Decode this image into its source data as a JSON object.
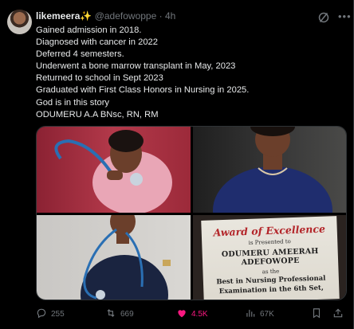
{
  "tweet": {
    "display_name": "likemeera",
    "sparkle_emoji": "✨",
    "handle": "@adefowoppe",
    "separator": "·",
    "time": "4h",
    "lines": [
      "Gained admission in 2018.",
      "Diagnosed with cancer in 2022",
      "Deferred 4 semesters.",
      "Underwent a bone marrow transplant in May, 2023",
      "Returned to school in Sept 2023",
      "Graduated  with First Class Honors in Nursing in 2025.",
      "God is in this story",
      "ODUMERU A.A BNsc, RN, RM"
    ]
  },
  "certificate": {
    "title": "Award of Excellence",
    "presented": "is Presented to",
    "name": "ODUMERU AMEERAH ADEFOWOPE",
    "as_the": "as the",
    "line1": "Best in Nursing Professional",
    "line2": "Examination in the 6th Set,"
  },
  "actions": {
    "replies": "255",
    "reposts": "669",
    "likes": "4.5K",
    "views": "67K"
  },
  "colors": {
    "background": "#000000",
    "text": "#e7e9ea",
    "muted": "#71767b",
    "like": "#f91880",
    "border": "#2f3336"
  },
  "icons": [
    "grok-icon",
    "more-icon",
    "reply-icon",
    "repost-icon",
    "heart-icon",
    "views-icon",
    "bookmark-icon",
    "share-icon"
  ]
}
